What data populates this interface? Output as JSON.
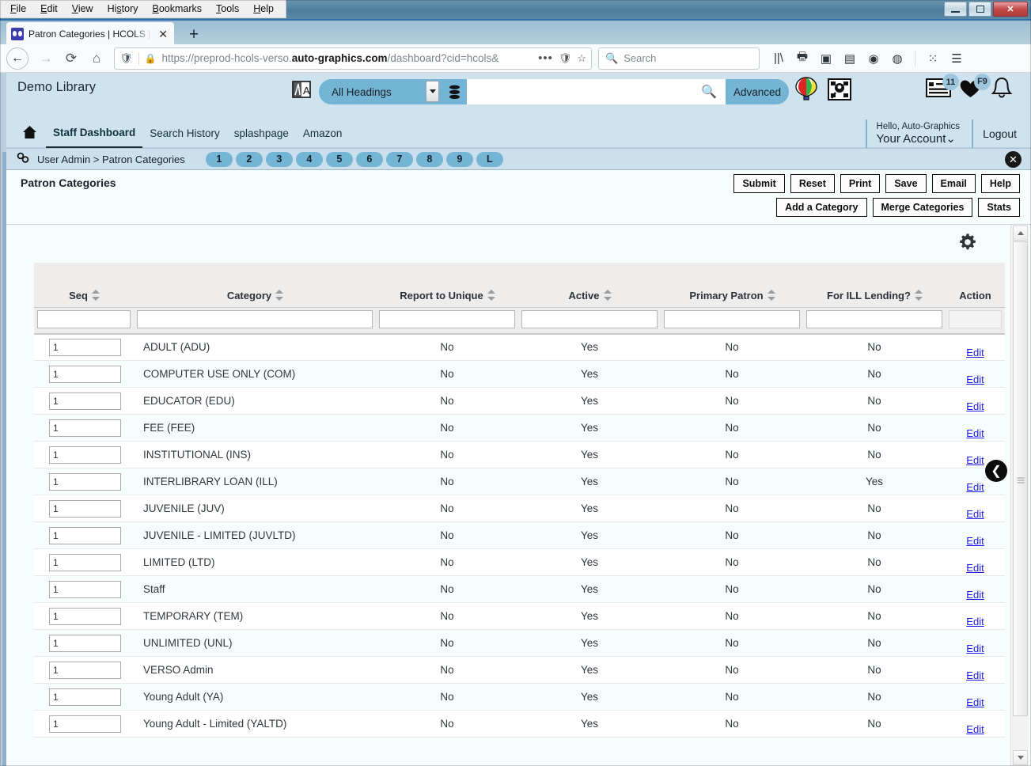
{
  "browser": {
    "menu": [
      "File",
      "Edit",
      "View",
      "History",
      "Bookmarks",
      "Tools",
      "Help"
    ],
    "window_controls": {
      "minimize": "–",
      "maximize": "❐",
      "close": "✕"
    },
    "tab": {
      "title": "Patron Categories | HCOLS | HC",
      "close": "✕",
      "newtab": "+"
    },
    "nav": {
      "back": "←",
      "forward": "→",
      "reload": "⟳",
      "home": "⌂"
    },
    "url": {
      "prefix": "https://preprod-hcols-verso.",
      "domain": "auto-graphics.com",
      "suffix": "/dashboard?cid=hcols&"
    },
    "search_placeholder": "Search",
    "toolbar_icons": [
      "library-icon",
      "print-icon",
      "pocket-icon",
      "sidebar-icon",
      "account-icon",
      "containers-icon",
      "extensions-icon",
      "hamburger-menu-icon"
    ]
  },
  "app": {
    "brand": "Demo Library",
    "search": {
      "scope": "All Headings",
      "query": "",
      "advanced_label": "Advanced",
      "magnifier": "search-icon",
      "database_icon": "database-icon",
      "language_icon": "translate-icon"
    },
    "header_icons": [
      "balloon-icon",
      "magnify-book-icon"
    ],
    "right_icons": [
      {
        "name": "list-icon",
        "badge": "11"
      },
      {
        "name": "heart-icon",
        "badge": "F9"
      },
      {
        "name": "bell-icon",
        "badge": ""
      }
    ],
    "nav_links": [
      {
        "label": "Staff Dashboard",
        "active": true
      },
      {
        "label": "Search History",
        "active": false
      },
      {
        "label": "splashpage",
        "active": false
      },
      {
        "label": "Amazon",
        "active": false
      }
    ],
    "account": {
      "hello": "Hello, Auto-Graphics",
      "your_account": "Your Account",
      "chevron": "⌄"
    },
    "logout": "Logout"
  },
  "breadcrumb": {
    "link_icon": "chain-link-icon",
    "text": "User Admin > Patron Categories",
    "page_buttons": [
      "1",
      "2",
      "3",
      "4",
      "5",
      "6",
      "7",
      "8",
      "9",
      "L"
    ],
    "close": "✕"
  },
  "page": {
    "title": "Patron Categories",
    "buttons_row1": [
      "Submit",
      "Reset",
      "Print",
      "Save",
      "Email",
      "Help"
    ],
    "buttons_row2": [
      "Add a Category",
      "Merge Categories",
      "Stats"
    ],
    "gear_icon": "gear-icon",
    "collapse_icon": "collapse-left-icon"
  },
  "table": {
    "columns": [
      "Seq",
      "Category",
      "Report to Unique",
      "Active",
      "Primary Patron",
      "For ILL Lending?",
      "Action"
    ],
    "filters": [
      "",
      "",
      "",
      "",
      "",
      ""
    ],
    "edit_label": "Edit",
    "rows": [
      {
        "seq": "1",
        "category": "ADULT (ADU)",
        "report_to_unique": "No",
        "active": "Yes",
        "primary_patron": "No",
        "for_ill_lending": "No"
      },
      {
        "seq": "1",
        "category": "COMPUTER USE ONLY (COM)",
        "report_to_unique": "No",
        "active": "Yes",
        "primary_patron": "No",
        "for_ill_lending": "No"
      },
      {
        "seq": "1",
        "category": "EDUCATOR (EDU)",
        "report_to_unique": "No",
        "active": "Yes",
        "primary_patron": "No",
        "for_ill_lending": "No"
      },
      {
        "seq": "1",
        "category": "FEE (FEE)",
        "report_to_unique": "No",
        "active": "Yes",
        "primary_patron": "No",
        "for_ill_lending": "No"
      },
      {
        "seq": "1",
        "category": "INSTITUTIONAL (INS)",
        "report_to_unique": "No",
        "active": "Yes",
        "primary_patron": "No",
        "for_ill_lending": "No"
      },
      {
        "seq": "1",
        "category": "INTERLIBRARY LOAN (ILL)",
        "report_to_unique": "No",
        "active": "Yes",
        "primary_patron": "No",
        "for_ill_lending": "Yes"
      },
      {
        "seq": "1",
        "category": "JUVENILE (JUV)",
        "report_to_unique": "No",
        "active": "Yes",
        "primary_patron": "No",
        "for_ill_lending": "No"
      },
      {
        "seq": "1",
        "category": "JUVENILE - LIMITED (JUVLTD)",
        "report_to_unique": "No",
        "active": "Yes",
        "primary_patron": "No",
        "for_ill_lending": "No"
      },
      {
        "seq": "1",
        "category": "LIMITED (LTD)",
        "report_to_unique": "No",
        "active": "Yes",
        "primary_patron": "No",
        "for_ill_lending": "No"
      },
      {
        "seq": "1",
        "category": "Staff",
        "report_to_unique": "No",
        "active": "Yes",
        "primary_patron": "No",
        "for_ill_lending": "No"
      },
      {
        "seq": "1",
        "category": "TEMPORARY (TEM)",
        "report_to_unique": "No",
        "active": "Yes",
        "primary_patron": "No",
        "for_ill_lending": "No"
      },
      {
        "seq": "1",
        "category": "UNLIMITED (UNL)",
        "report_to_unique": "No",
        "active": "Yes",
        "primary_patron": "No",
        "for_ill_lending": "No"
      },
      {
        "seq": "1",
        "category": "VERSO Admin",
        "report_to_unique": "No",
        "active": "Yes",
        "primary_patron": "No",
        "for_ill_lending": "No"
      },
      {
        "seq": "1",
        "category": "Young Adult (YA)",
        "report_to_unique": "No",
        "active": "Yes",
        "primary_patron": "No",
        "for_ill_lending": "No"
      },
      {
        "seq": "1",
        "category": "Young Adult - Limited (YALTD)",
        "report_to_unique": "No",
        "active": "Yes",
        "primary_patron": "No",
        "for_ill_lending": "No"
      }
    ]
  },
  "colors": {
    "app_header": "#cfe3ee",
    "accent_blue": "#74b4d4",
    "link_blue": "#1a1ae0",
    "table_header": "#efedec",
    "page_bg": "#f7fcfd"
  }
}
